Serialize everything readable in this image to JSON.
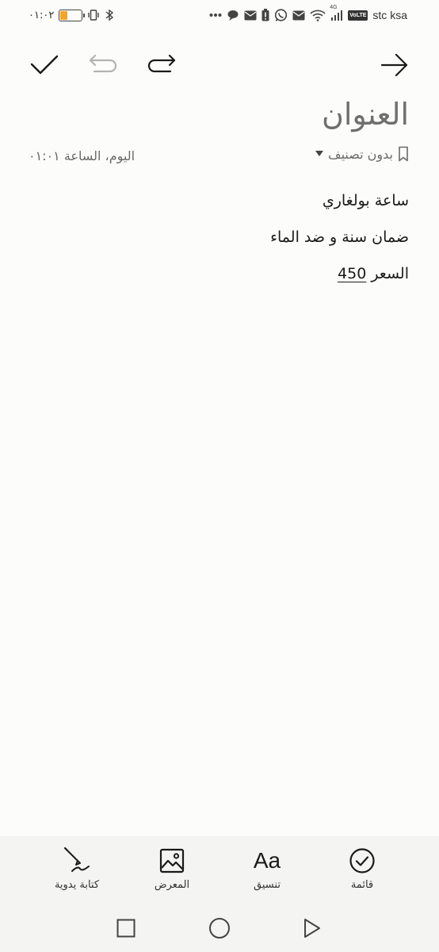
{
  "status_bar": {
    "time": "٠١:٠٢",
    "carrier": "stc ksa",
    "volte": "VoLTE",
    "network": "4G",
    "battery_level": 0.35,
    "battery_color": "#f3a42b"
  },
  "toolbar": {
    "save_icon": "checkmark-icon",
    "undo_icon": "undo-icon",
    "redo_icon": "redo-icon",
    "back_icon": "arrow-right-icon"
  },
  "note": {
    "title": "العنوان",
    "category": "بدون تصنيف",
    "timestamp": "اليوم، الساعة ٠١:٠١",
    "lines": [
      "ساعة بولغاري",
      "ضمان سنة و ضد الماء"
    ],
    "price_label": "السعر",
    "price_value": "450"
  },
  "bottom_tools": {
    "checklist": "قائمة",
    "format": "تنسيق",
    "format_glyph": "Aa",
    "gallery": "المعرض",
    "handwriting": "كتابة يدوية"
  }
}
